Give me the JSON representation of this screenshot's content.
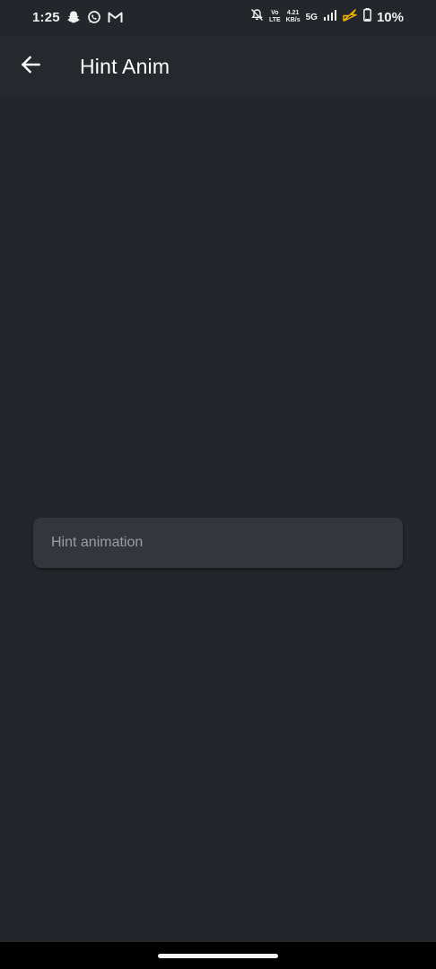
{
  "status_bar": {
    "time": "1:25",
    "left_icons": [
      "snapchat-icon",
      "whatsapp-icon",
      "gmail-icon"
    ],
    "right": {
      "mute_icon": "bell-off-icon",
      "volte_top": "Vo",
      "volte_bottom": "LTE",
      "speed_value": "4.21",
      "speed_unit": "KB/s",
      "network": "5G",
      "signal_icon": "signal-icon",
      "charging_icon": "lightning-icon",
      "battery_icon": "battery-icon",
      "battery_percent": "10%"
    }
  },
  "app_bar": {
    "back_icon": "arrow-left-icon",
    "title": "Hint Anim"
  },
  "main": {
    "hint_field": {
      "value": "",
      "placeholder": "Hint animation"
    }
  },
  "colors": {
    "background": "#23262b",
    "app_bar": "#25282d",
    "field_bg": "#33373b",
    "placeholder": "#9a9ea3",
    "charging_accent": "#f0b400"
  }
}
